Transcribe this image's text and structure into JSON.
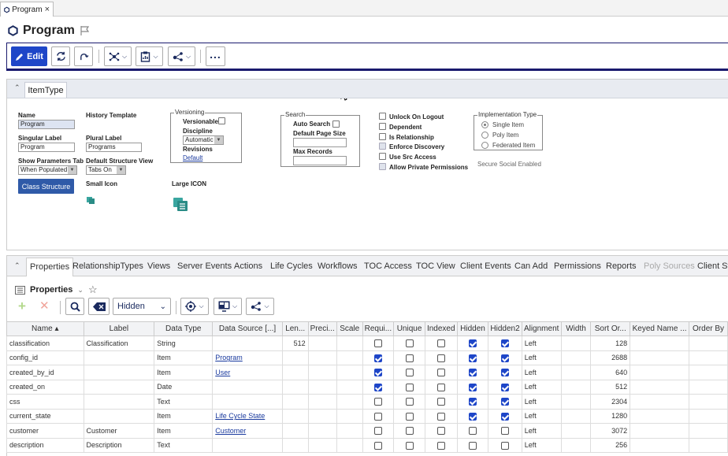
{
  "tab": {
    "label": "Program",
    "close": "×"
  },
  "title": "Program",
  "toolbar": {
    "edit_label": "Edit"
  },
  "form": {
    "section_tab": "ItemType",
    "name_label": "Name",
    "name_value": "Program",
    "singular_label": "Singular Label",
    "singular_value": "Program",
    "show_params_label": "Show Parameters Tab",
    "show_params_value": "When Populated",
    "class_structure_btn": "Class Structure",
    "history_template_label": "History Template",
    "plural_label": "Plural Label",
    "plural_value": "Programs",
    "default_structure_label": "Default Structure View",
    "default_structure_value": "Tabs On",
    "small_icon_label": "Small Icon",
    "large_icon_label": "Large ICON",
    "versioning": {
      "legend": "Versioning",
      "versionable": "Versionable",
      "discipline": "Discipline",
      "discipline_value": "Automatic",
      "revisions": "Revisions",
      "revisions_value": "Default"
    },
    "search": {
      "legend": "Search",
      "auto_search": "Auto Search",
      "default_page_size": "Default Page Size",
      "max_records": "Max Records"
    },
    "options": [
      {
        "label": "Unlock On Logout",
        "checked": false
      },
      {
        "label": "Dependent",
        "checked": false
      },
      {
        "label": "Is Relationship",
        "checked": false
      },
      {
        "label": "Enforce Discovery",
        "checked": true
      },
      {
        "label": "Use Src Access",
        "checked": false
      },
      {
        "label": "Allow Private Permissions",
        "checked": true
      }
    ],
    "implementation": {
      "legend": "Implementation Type",
      "single": "Single Item",
      "poly": "Poly Item",
      "federated": "Federated Item"
    },
    "secure_social": "Secure Social Enabled"
  },
  "rel_tabs": [
    "Properties",
    "RelationshipTypes",
    "Views",
    "Server Events",
    "Actions",
    "Life Cycles",
    "Workflows",
    "TOC Access",
    "TOC View",
    "Client Events",
    "Can Add",
    "Permissions",
    "Reports",
    "Poly Sources",
    "Client St"
  ],
  "properties": {
    "title": "Properties",
    "hidden_select": "Hidden"
  },
  "grid": {
    "columns": [
      "Name ▴",
      "Label",
      "Data Type",
      "Data Source [...]",
      "Len...",
      "Preci...",
      "Scale",
      "Requi...",
      "Unique",
      "Indexed",
      "Hidden",
      "Hidden2",
      "Alignment",
      "Width",
      "Sort Or...",
      "Keyed Name ...",
      "Order By"
    ],
    "rows": [
      {
        "name": "classification",
        "label": "Classification",
        "type": "String",
        "source": "",
        "len": "512",
        "req": false,
        "uniq": false,
        "idx": false,
        "hid": true,
        "hid2": true,
        "align": "Left",
        "sort": "128"
      },
      {
        "name": "config_id",
        "label": "",
        "type": "Item",
        "source": "Program",
        "len": "",
        "req": true,
        "uniq": false,
        "idx": false,
        "hid": true,
        "hid2": true,
        "align": "Left",
        "sort": "2688"
      },
      {
        "name": "created_by_id",
        "label": "",
        "type": "Item",
        "source": "User",
        "len": "",
        "req": true,
        "uniq": false,
        "idx": false,
        "hid": true,
        "hid2": true,
        "align": "Left",
        "sort": "640"
      },
      {
        "name": "created_on",
        "label": "",
        "type": "Date",
        "source": "",
        "len": "",
        "req": true,
        "uniq": false,
        "idx": false,
        "hid": true,
        "hid2": true,
        "align": "Left",
        "sort": "512"
      },
      {
        "name": "css",
        "label": "",
        "type": "Text",
        "source": "",
        "len": "",
        "req": false,
        "uniq": false,
        "idx": false,
        "hid": true,
        "hid2": true,
        "align": "Left",
        "sort": "2304"
      },
      {
        "name": "current_state",
        "label": "",
        "type": "Item",
        "source": "Life Cycle State",
        "len": "",
        "req": false,
        "uniq": false,
        "idx": false,
        "hid": true,
        "hid2": true,
        "align": "Left",
        "sort": "1280"
      },
      {
        "name": "customer",
        "label": "Customer",
        "type": "Item",
        "source": "Customer",
        "len": "",
        "req": false,
        "uniq": false,
        "idx": false,
        "hid": false,
        "hid2": false,
        "align": "Left",
        "sort": "3072"
      },
      {
        "name": "description",
        "label": "Description",
        "type": "Text",
        "source": "",
        "len": "",
        "req": false,
        "uniq": false,
        "idx": false,
        "hid": false,
        "hid2": false,
        "align": "Left",
        "sort": "256"
      }
    ]
  }
}
